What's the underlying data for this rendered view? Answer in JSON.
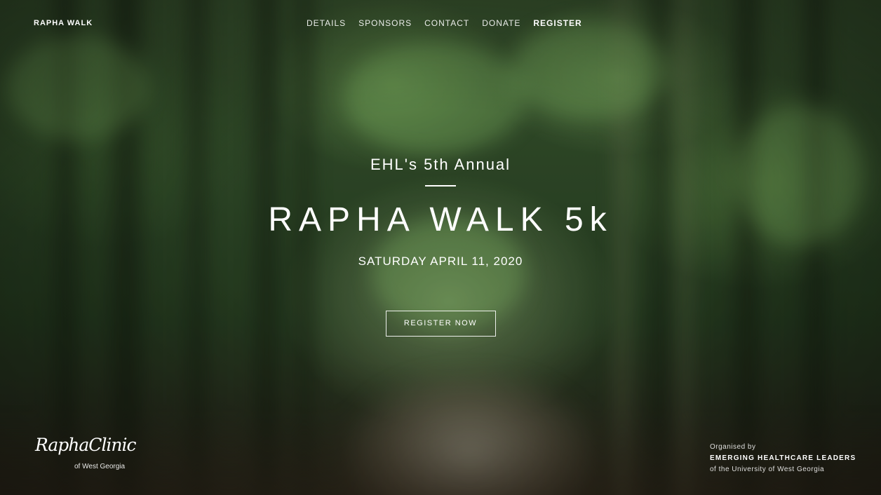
{
  "brand": {
    "label": "RAPHA WALK"
  },
  "nav": {
    "items": [
      {
        "label": "DETAILS"
      },
      {
        "label": "SPONSORS"
      },
      {
        "label": "CONTACT"
      },
      {
        "label": "DONATE"
      },
      {
        "label": "REGISTER"
      }
    ]
  },
  "hero": {
    "subtitle": "EHL's 5th Annual",
    "title": "RAPHA WALK 5k",
    "date": "SATURDAY APRIL 11, 2020",
    "cta_label": "REGISTER NOW"
  },
  "logo": {
    "name": "RaphaClinic",
    "subtitle": "of West Georgia"
  },
  "credits": {
    "organised_by": "Organised by",
    "organization": "EMERGING HEALTHCARE LEADERS",
    "affiliation": "of the University of West Georgia"
  },
  "colors": {
    "text": "#ffffff",
    "background_dominant": "#2f4a28"
  }
}
